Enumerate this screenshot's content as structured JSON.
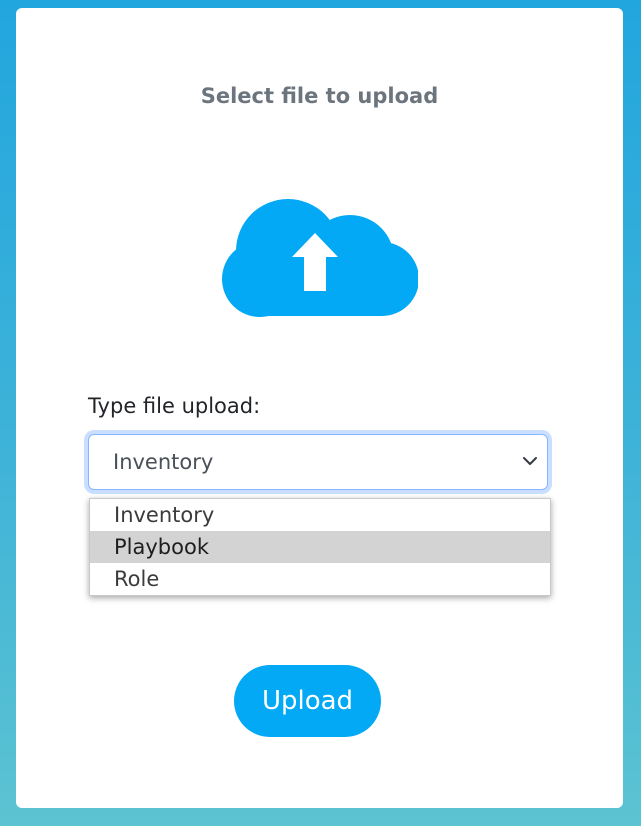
{
  "title": "Select file to upload",
  "upload_icon": "cloud-upload-icon",
  "form": {
    "label": "Type file upload:",
    "selected_value": "Inventory",
    "options": [
      "Inventory",
      "Playbook",
      "Role"
    ],
    "highlighted_option": "Playbook"
  },
  "upload_button": {
    "label": "Upload"
  },
  "colors": {
    "accent": "#03a9f4",
    "title_text": "#6c757d",
    "focus_border": "#86b7fe",
    "option_highlight": "#d3d3d3"
  }
}
